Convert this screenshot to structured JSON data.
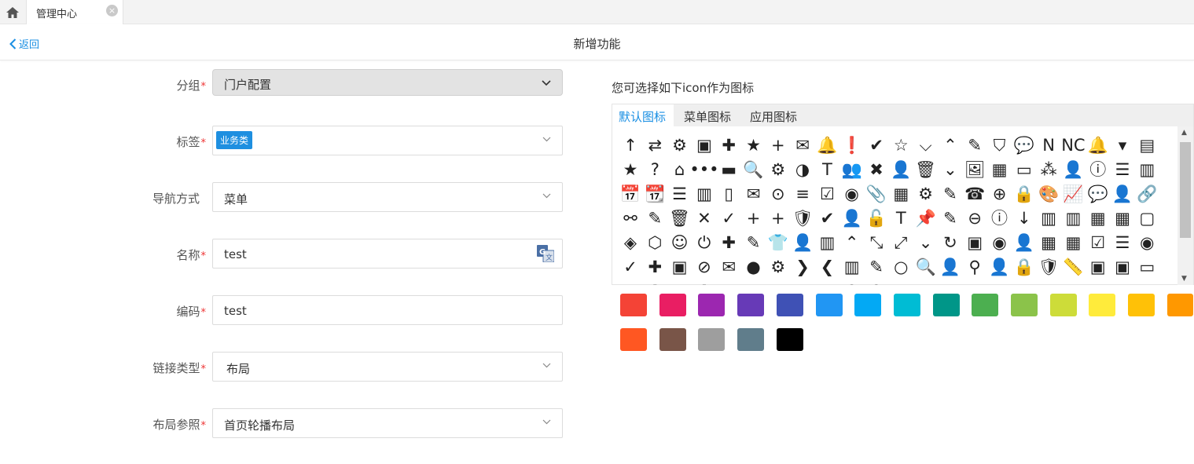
{
  "topbar": {
    "tab_label": "管理中心",
    "close_glyph": "×"
  },
  "header": {
    "back_label": "返回",
    "title": "新增功能"
  },
  "form": {
    "group": {
      "label": "分组",
      "value": "门户配置"
    },
    "tags": {
      "label": "标签",
      "chip": "业务类"
    },
    "nav": {
      "label": "导航方式",
      "value": "菜单"
    },
    "name": {
      "label": "名称",
      "value": "test"
    },
    "code": {
      "label": "编码",
      "value": "test"
    },
    "link_type": {
      "label": "链接类型",
      "value": "布局"
    },
    "layout_ref": {
      "label": "布局参照",
      "value": "首页轮播布局"
    },
    "required_mark": "*"
  },
  "icons_section": {
    "title": "您可选择如下icon作为图标",
    "tabs": [
      "默认图标",
      "菜单图标",
      "应用图标"
    ],
    "active_tab": 0,
    "glyph_rows": [
      [
        "↑",
        "⇄",
        "⚙",
        "▣",
        "✚",
        "★",
        "+",
        "✉",
        "🔔",
        "❗",
        "✔",
        "☆",
        "⌵",
        "⌃",
        "✎",
        "⛉",
        "💬",
        "N",
        "NC",
        "🔔",
        "▾",
        "▤"
      ],
      [
        "★",
        "?",
        "⌂",
        "•••",
        "▬",
        "🔍",
        "⚙",
        "◑",
        "T",
        "👥",
        "✖",
        "👤",
        "🗑",
        "⌄",
        "🖼",
        "▦",
        "▭",
        "⁂",
        "👤",
        "ⓘ",
        "☰",
        "▥"
      ],
      [
        "📅",
        "📆",
        "☰",
        "▥",
        "▯",
        "✉",
        "⊙",
        "≡",
        "☑",
        "◉",
        "📎",
        "▦",
        "⚙",
        "✎",
        "☎",
        "⊕",
        "🔒",
        "🎨",
        "📈",
        "💬",
        "👤",
        "🔗"
      ],
      [
        "⚯",
        "✎",
        "🗑",
        "✕",
        "✓",
        "+",
        "+",
        "🛡",
        "✔",
        "👤",
        "🔓",
        "T",
        "📌",
        "✎",
        "⊖",
        "ⓘ",
        "↓",
        "▥",
        "▥",
        "▦",
        "▦",
        "▢"
      ],
      [
        "◈",
        "⬡",
        "☺",
        "⏻",
        "✚",
        "✎",
        "👕",
        "👤",
        "▥",
        "⌃",
        "⤡",
        "⤢",
        "⌄",
        "↻",
        "▣",
        "◉",
        "👤",
        "▦",
        "▦",
        "☑",
        "☰",
        "◉"
      ],
      [
        "✓",
        "✚",
        "▣",
        "⊘",
        "✉",
        "●",
        "⚙",
        "❯",
        "❮",
        "▥",
        "✎",
        "○",
        "🔍",
        "👤",
        "⚲",
        "👤",
        "🔒",
        "🛡",
        "📏",
        "▣",
        "▣",
        "▭"
      ],
      [
        "▣",
        "✚",
        "✎",
        "✚",
        "●",
        "○",
        "□",
        "○",
        "●",
        "⚲",
        "⚲",
        "▭",
        "○",
        "▭",
        "○",
        "▭",
        "○",
        "▭",
        "✎",
        "●",
        "○",
        "○"
      ]
    ],
    "swatches": [
      "#f44336",
      "#e91e63",
      "#9c27b0",
      "#673ab7",
      "#3f51b5",
      "#2196f3",
      "#03a9f4",
      "#00bcd4",
      "#009688",
      "#4caf50",
      "#8bc34a",
      "#cddc39",
      "#ffeb3b",
      "#ffc107",
      "#ff9800",
      "#ff5722",
      "#795548",
      "#9e9e9e",
      "#607d8b",
      "#000000"
    ]
  }
}
